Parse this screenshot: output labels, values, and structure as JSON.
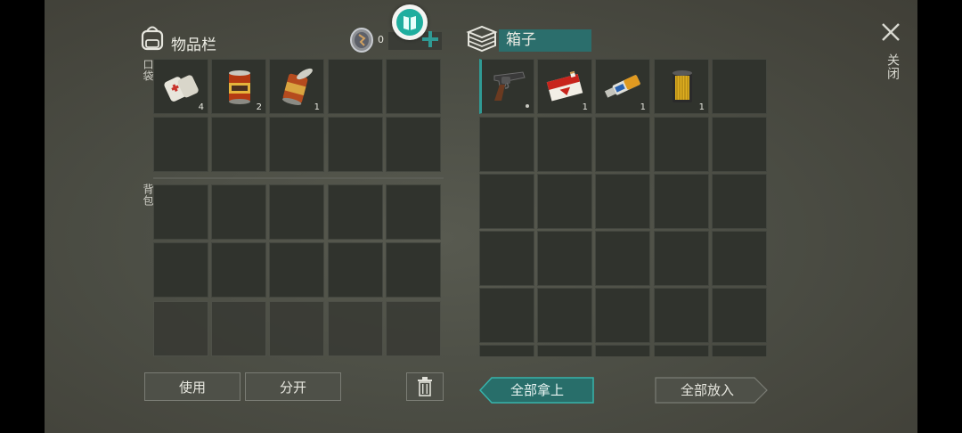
{
  "inventory": {
    "title": "物品栏",
    "currency_value": "0",
    "pocket_label": "口袋",
    "backpack_label": "背包",
    "pocket_items": [
      {
        "icon": "medical-bandage-icon",
        "count": "4"
      },
      {
        "icon": "food-can-icon",
        "count": "2"
      },
      {
        "icon": "open-can-icon",
        "count": "1"
      }
    ]
  },
  "box": {
    "title": "箱子",
    "items": [
      {
        "icon": "revolver-icon",
        "count": ""
      },
      {
        "icon": "cigarette-pack-icon",
        "count": "1"
      },
      {
        "icon": "usb-drive-icon",
        "count": "1"
      },
      {
        "icon": "oil-filter-icon",
        "count": "1"
      }
    ]
  },
  "buttons": {
    "use": "使用",
    "split": "分开",
    "take_all": "全部拿上",
    "put_all": "全部放入"
  },
  "close_label": "关闭",
  "colors": {
    "accent": "#2f9a94",
    "slot": "#30332d",
    "background": "#4c4e45"
  }
}
